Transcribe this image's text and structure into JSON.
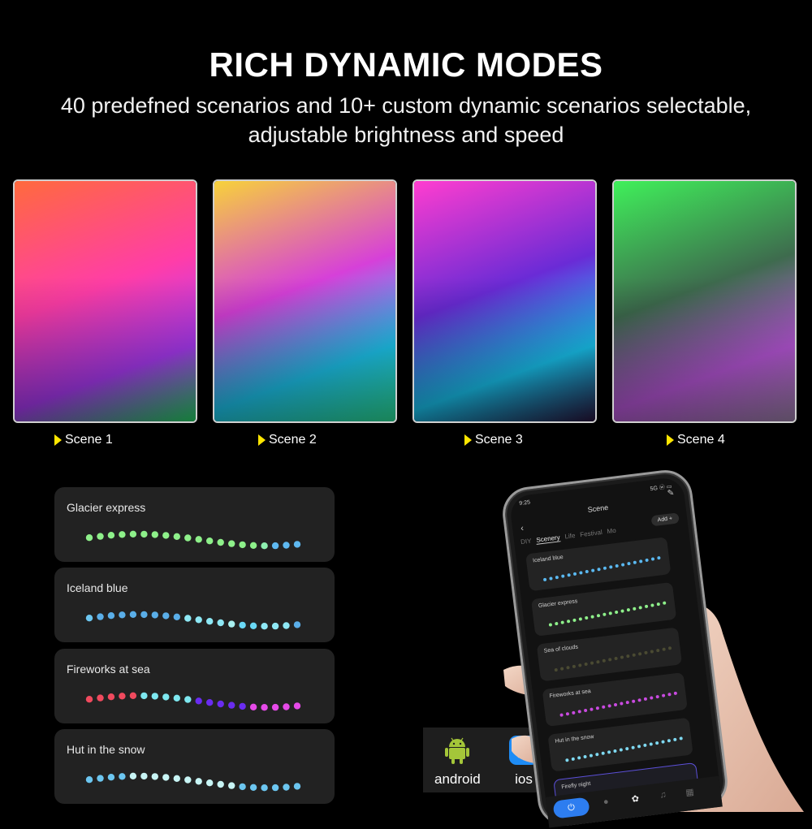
{
  "header": {
    "title": "RICH DYNAMIC MODES",
    "subtitle_line1": "40 predefned scenarios and 10+ custom dynamic scenarios selectable,",
    "subtitle_line2": "adjustable brightness and speed"
  },
  "scenes": [
    {
      "label": "Scene 1",
      "icon": "play-triangle-icon",
      "palette": [
        "#ff6a3d",
        "#ff3da8",
        "#b23dff",
        "#27e36b"
      ]
    },
    {
      "label": "Scene 2",
      "icon": "play-triangle-icon",
      "palette": [
        "#f7d23a",
        "#d640d9",
        "#1fd3ff",
        "#2ef0a0"
      ]
    },
    {
      "label": "Scene 3",
      "icon": "play-triangle-icon",
      "palette": [
        "#ff3dcf",
        "#6a2bd6",
        "#1ad0ff",
        "#2a1440"
      ]
    },
    {
      "label": "Scene 4",
      "icon": "play-triangle-icon",
      "palette": [
        "#3ff05a",
        "#3e6b4e",
        "#c35ce6",
        "#a78bb5"
      ]
    }
  ],
  "effect_cards": [
    {
      "name": "Glacier express",
      "colors": [
        "#8ef08a",
        "#8ef08a",
        "#8ef08a",
        "#8ef08a",
        "#8ef08a",
        "#8ef08a",
        "#8ef08a",
        "#8ef08a",
        "#8ef08a",
        "#8ef08a",
        "#8ef08a",
        "#8ef08a",
        "#8ef08a",
        "#8ef08a",
        "#8ef08a",
        "#8ef08a",
        "#8ef0b0",
        "#5eb8f0",
        "#5eb8f0",
        "#5eb8f0"
      ]
    },
    {
      "name": "Iceland blue",
      "colors": [
        "#6cc6f0",
        "#5aaee8",
        "#5aaee8",
        "#5aaee8",
        "#5aaee8",
        "#5aaee8",
        "#5aaee8",
        "#5aaee8",
        "#5aaee8",
        "#8ee8f5",
        "#8ee8f5",
        "#8ee8f5",
        "#8ee8f5",
        "#a8f0f0",
        "#6ad8f5",
        "#6ad8f5",
        "#8ee8f5",
        "#8ee8f5",
        "#8ee8f5",
        "#5aaee8"
      ]
    },
    {
      "name": "Fireworks at sea",
      "colors": [
        "#f04a5e",
        "#f04a5e",
        "#f04a5e",
        "#f04a5e",
        "#f04a5e",
        "#7ee8f0",
        "#7ee8f0",
        "#7ee8f0",
        "#7ee8f0",
        "#7ee8f0",
        "#6a2cf0",
        "#6a2cf0",
        "#6a2cf0",
        "#6a2cf0",
        "#6a2cf0",
        "#e64ae8",
        "#e64ae8",
        "#e64ae8",
        "#e64ae8",
        "#e64ae8"
      ]
    },
    {
      "name": "Hut in the snow",
      "colors": [
        "#6cc6f0",
        "#6cc6f0",
        "#6cc6f0",
        "#6cc6f0",
        "#c8f5f5",
        "#c8f5f5",
        "#c8f5f5",
        "#c8f5f5",
        "#c8f5f5",
        "#c8f5f5",
        "#c8f5f5",
        "#c8f5f5",
        "#c8f5f5",
        "#c8f5f5",
        "#6cc6f0",
        "#6cc6f0",
        "#6cc6f0",
        "#6cc6f0",
        "#6cc6f0",
        "#6cc6f0"
      ]
    }
  ],
  "store": {
    "android_label": "android",
    "ios_label": "ios",
    "android_color": "#a4c639",
    "ios_color": "#1e8cf5"
  },
  "phone": {
    "status_time": "9:25",
    "status_right": "5G ⓦ ▭",
    "screen_title": "Scene",
    "back_icon": "‹",
    "edit_icon": "✎",
    "tabs": [
      "DIY",
      "Scenery",
      "Life",
      "Festival",
      "Mo"
    ],
    "active_tab": "Scenery",
    "add_button": "Add +",
    "list": [
      {
        "name": "Iceland blue",
        "color": "#5ab8f0"
      },
      {
        "name": "Glacier express",
        "color": "#8ef08a"
      },
      {
        "name": "Sea of clouds",
        "color": "#4a4a32"
      },
      {
        "name": "Fireworks at sea",
        "color": "#c94ae0"
      },
      {
        "name": "Hut in the snow",
        "color": "#7ed8f0"
      }
    ],
    "active_item": "Firefly night",
    "nav_power": "⏻",
    "nav_icons": [
      "bulb-icon",
      "palette-icon",
      "music-icon",
      "grid-icon"
    ]
  }
}
